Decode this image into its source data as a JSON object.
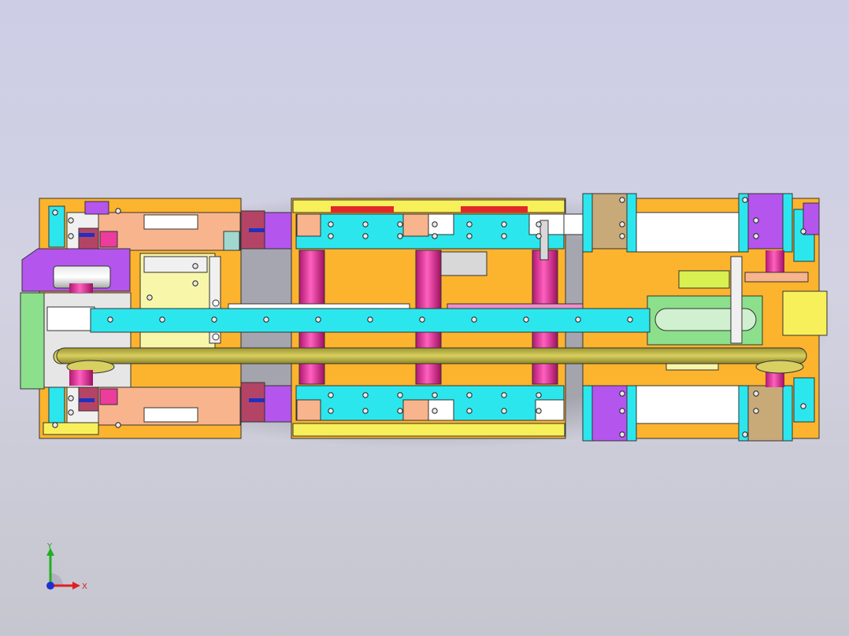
{
  "viewport": {
    "background_top": "#cdcde6",
    "background_bottom": "#c6c6cf"
  },
  "model": {
    "description_colors": {
      "orange": "#fcb42e",
      "cyan": "#2ce6ee",
      "magenta": "#ec3c9c",
      "purple": "#b455ee",
      "olive": "#c8bc3c",
      "green": "#8ce08c",
      "salmon": "#f8b48c",
      "maroon": "#b44466",
      "tan": "#c8aa78",
      "yellow": "#f8f05a"
    }
  },
  "triad": {
    "x_label": "X",
    "y_label": "Y",
    "x_color": "#e02020",
    "y_color": "#20b020",
    "z_color": "#2030d0"
  }
}
